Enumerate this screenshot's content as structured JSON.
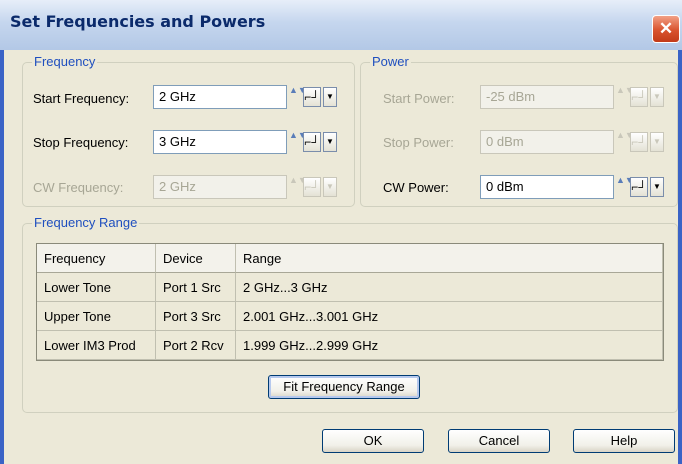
{
  "window": {
    "title": "Set Frequencies and Powers",
    "close_glyph": "✕"
  },
  "frequency": {
    "legend": "Frequency",
    "start_label": "Start Frequency:",
    "start_value": "2 GHz",
    "stop_label": "Stop Frequency:",
    "stop_value": "3 GHz",
    "cw_label": "CW Frequency:",
    "cw_value": "2 GHz"
  },
  "power": {
    "legend": "Power",
    "start_label": "Start Power:",
    "start_value": "-25 dBm",
    "stop_label": "Stop Power:",
    "stop_value": "0 dBm",
    "cw_label": "CW Power:",
    "cw_value": "0 dBm"
  },
  "range": {
    "legend": "Frequency Range",
    "columns": [
      "Frequency",
      "Device",
      "Range"
    ],
    "rows": [
      [
        "Lower Tone",
        "Port 1 Src",
        "2 GHz...3 GHz"
      ],
      [
        "Upper Tone",
        "Port 3 Src",
        "2.001 GHz...3.001 GHz"
      ],
      [
        "Lower IM3 Prod",
        "Port 2 Rcv",
        "1.999 GHz...2.999 GHz"
      ]
    ],
    "fit_button": "Fit Frequency Range"
  },
  "buttons": {
    "ok": "OK",
    "cancel": "Cancel",
    "help": "Help"
  },
  "glyphs": {
    "spin": "▲▼",
    "step": "⌐┘",
    "drop": "▼"
  }
}
